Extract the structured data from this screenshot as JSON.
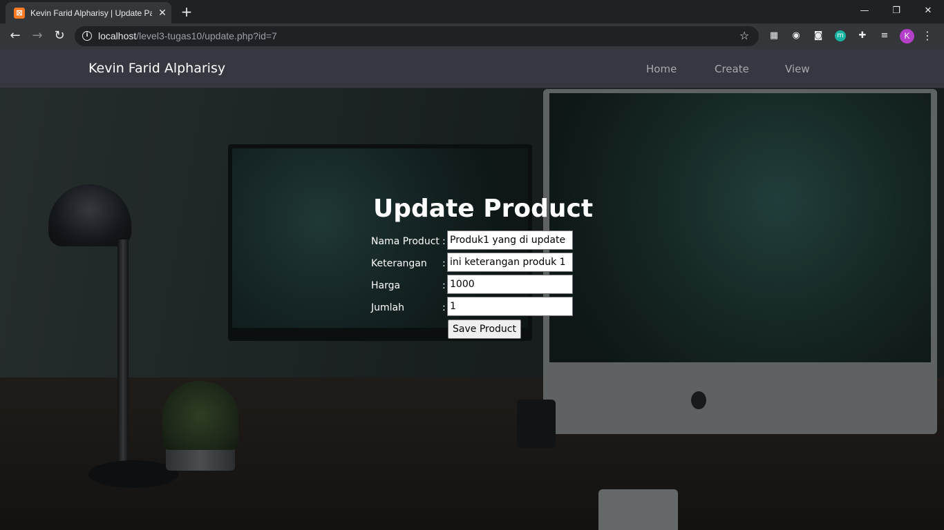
{
  "browser": {
    "tab_title": "Kevin Farid Alpharisy | Update Page",
    "tab_icon": "xampp-icon",
    "tab_close": "✕",
    "new_tab": "+",
    "window_controls": {
      "minimize": "—",
      "restore": "❐",
      "close": "✕"
    },
    "nav": {
      "back": "←",
      "forward": "→",
      "reload": "↻"
    },
    "url_host": "localhost",
    "url_path": "/level3-tugas10/update.php?id=7",
    "info_icon": "i",
    "star": "☆",
    "extensions": [
      "▦",
      "◉",
      "◙",
      "m",
      "✚",
      "≡"
    ],
    "profile_initial": "K",
    "menu": "⋮"
  },
  "navbar": {
    "brand": "Kevin Farid Alpharisy",
    "links": [
      "Home",
      "Create",
      "View"
    ]
  },
  "form": {
    "title": "Update Product",
    "fields": [
      {
        "label": "Nama Product",
        "value": "Produk1 yang di update"
      },
      {
        "label": "Keterangan",
        "value": "ini keterangan produk 1"
      },
      {
        "label": "Harga",
        "value": "1000"
      },
      {
        "label": "Jumlah",
        "value": "1"
      }
    ],
    "colon": ":",
    "submit_label": "Save Product"
  }
}
